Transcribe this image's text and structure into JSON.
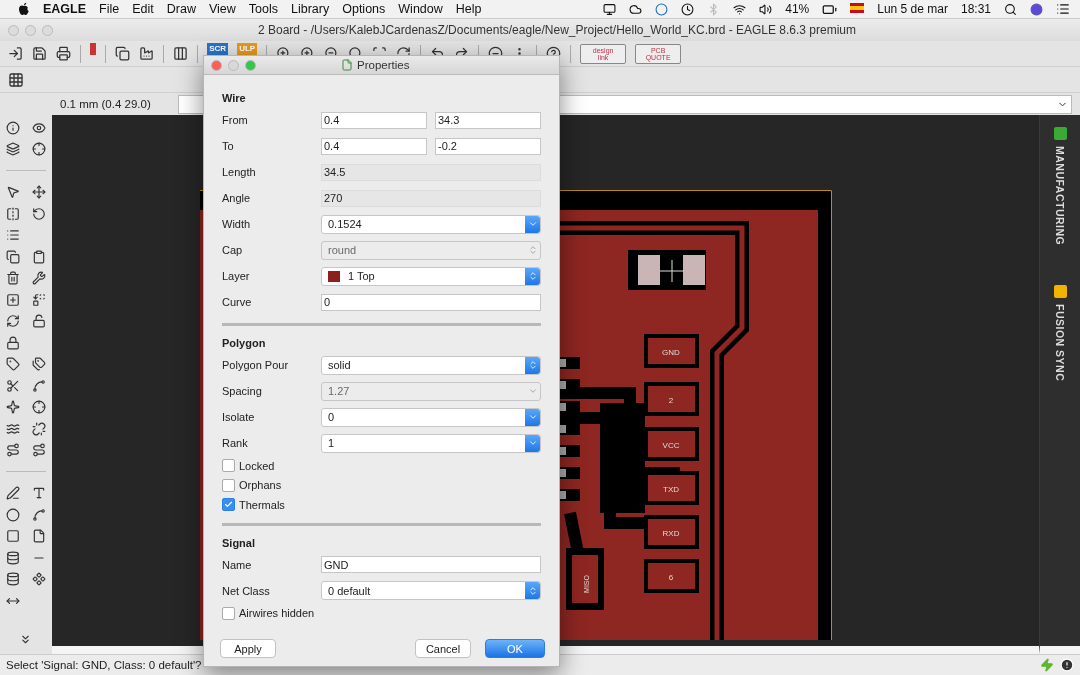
{
  "menu_bar": {
    "app": "EAGLE",
    "menus": [
      "File",
      "Edit",
      "Draw",
      "View",
      "Tools",
      "Library",
      "Options",
      "Window",
      "Help"
    ],
    "battery": "41%",
    "date": "Lun 5 de mar",
    "time": "18:31"
  },
  "window": {
    "title": "2 Board - /Users/KalebJCardenasZ/Documents/eagle/New_Project/Hello_World_KC.brd - EAGLE 8.6.3 premium"
  },
  "toolbar": {
    "script_badges": [
      "SCR",
      "ULP"
    ],
    "design_link": [
      "design",
      "link"
    ],
    "pcb_quote": [
      "PCB",
      "QUOTE"
    ]
  },
  "command_bar": {
    "coordinates": "0.1 mm (0.4 29.0)"
  },
  "canvas": {
    "pads": [
      {
        "label": "GND"
      },
      {
        "label": "2"
      },
      {
        "label": "VCC"
      },
      {
        "label": "TXD"
      },
      {
        "label": "RXD"
      },
      {
        "label": "6"
      }
    ],
    "pin_label": "MISO",
    "side_tabs": [
      {
        "label": "MANUFACTURING",
        "color": "#3aa935"
      },
      {
        "label": "FUSION SYNC",
        "color": "#f0b400"
      }
    ]
  },
  "dialog": {
    "title": "Properties",
    "sections": [
      {
        "title": "Wire",
        "rows": [
          {
            "kind": "pair",
            "label": "From",
            "values": [
              "0.4",
              "34.3"
            ],
            "disabled": false
          },
          {
            "kind": "pair",
            "label": "To",
            "values": [
              "0.4",
              "-0.2"
            ],
            "disabled": false
          },
          {
            "kind": "text",
            "label": "Length",
            "value": "34.5",
            "disabled": true
          },
          {
            "kind": "text",
            "label": "Angle",
            "value": "270",
            "disabled": true
          },
          {
            "kind": "combo",
            "label": "Width",
            "value": "0.1524",
            "disabled": false
          },
          {
            "kind": "select",
            "label": "Cap",
            "value": "round",
            "disabled": true
          },
          {
            "kind": "select",
            "label": "Layer",
            "value": "1 Top",
            "color": "#8e1f1c",
            "disabled": false
          },
          {
            "kind": "text",
            "label": "Curve",
            "value": "0",
            "disabled": false
          }
        ]
      },
      {
        "title": "Polygon",
        "rows": [
          {
            "kind": "select",
            "label": "Polygon Pour",
            "value": "solid",
            "disabled": false
          },
          {
            "kind": "combo",
            "label": "Spacing",
            "value": "1.27",
            "disabled": true
          },
          {
            "kind": "combo",
            "label": "Isolate",
            "value": "0",
            "disabled": false
          },
          {
            "kind": "combo",
            "label": "Rank",
            "value": "1",
            "disabled": false
          },
          {
            "kind": "check",
            "label": "Locked",
            "checked": false
          },
          {
            "kind": "check",
            "label": "Orphans",
            "checked": false
          },
          {
            "kind": "check",
            "label": "Thermals",
            "checked": true
          }
        ]
      },
      {
        "title": "Signal",
        "rows": [
          {
            "kind": "text",
            "label": "Name",
            "value": "GND",
            "disabled": false
          },
          {
            "kind": "select",
            "label": "Net Class",
            "value": "0 default",
            "disabled": false
          },
          {
            "kind": "check",
            "label": "Airwires hidden",
            "checked": false
          }
        ]
      }
    ],
    "buttons": [
      {
        "label": "Apply",
        "default": false
      },
      {
        "label": "Cancel",
        "default": false
      },
      {
        "label": "OK",
        "default": true
      }
    ]
  },
  "status_bar": {
    "message": "Select 'Signal: GND, Class: 0 default'?"
  }
}
